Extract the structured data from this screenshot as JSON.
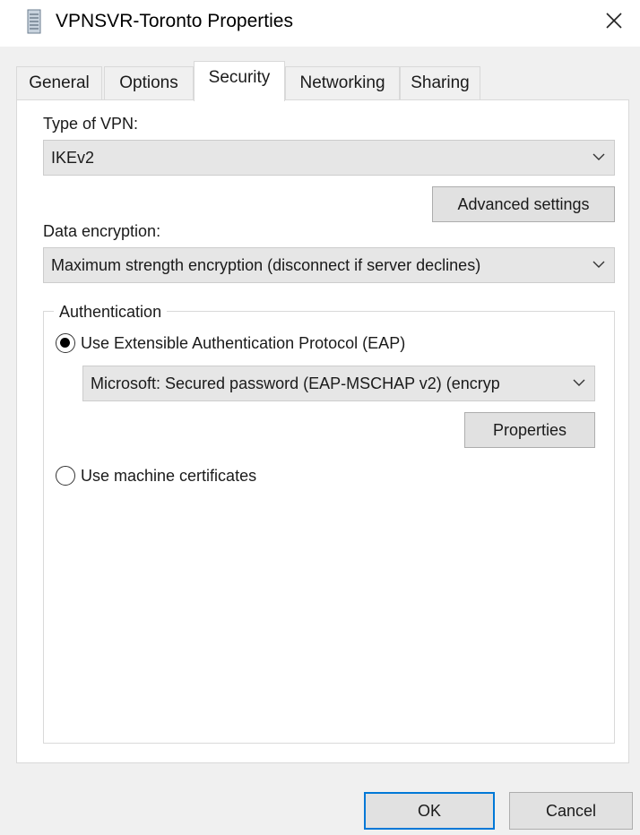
{
  "window": {
    "title": "VPNSVR-Toronto Properties",
    "close_icon": "close-icon",
    "app_icon": "network-connection-icon"
  },
  "tabs": [
    {
      "label": "General",
      "active": false
    },
    {
      "label": "Options",
      "active": false
    },
    {
      "label": "Security",
      "active": true
    },
    {
      "label": "Networking",
      "active": false
    },
    {
      "label": "Sharing",
      "active": false
    }
  ],
  "security": {
    "vpn_type_label": "Type of VPN:",
    "vpn_type_value": "IKEv2",
    "advanced_settings_label": "Advanced settings",
    "data_encryption_label": "Data encryption:",
    "data_encryption_value": "Maximum strength encryption (disconnect if server declines)",
    "authentication": {
      "group_label": "Authentication",
      "eap_option_label": "Use Extensible Authentication Protocol (EAP)",
      "eap_selected": true,
      "eap_method_value": "Microsoft: Secured password (EAP-MSCHAP v2) (encryp",
      "properties_label": "Properties",
      "machine_cert_label": "Use machine certificates",
      "machine_cert_selected": false
    }
  },
  "footer": {
    "ok_label": "OK",
    "cancel_label": "Cancel"
  },
  "colors": {
    "accent": "#0078d7",
    "dialog_bg": "#f0f0f0",
    "panel_bg": "#ffffff"
  }
}
